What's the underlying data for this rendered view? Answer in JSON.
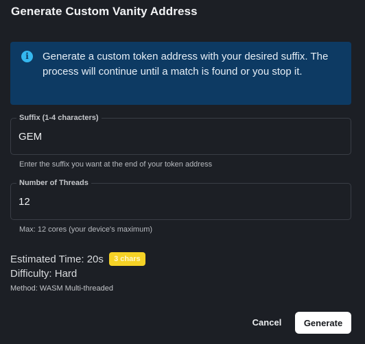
{
  "dialog": {
    "title": "Generate Custom Vanity Address"
  },
  "info": {
    "icon": "info-icon",
    "text": "Generate a custom token address with your desired suffix. The process will continue until a match is found or you stop it."
  },
  "suffix": {
    "label": "Suffix (1-4 characters)",
    "value": "GEM",
    "helper": "Enter the suffix you want at the end of your token address"
  },
  "threads": {
    "label": "Number of Threads",
    "value": "12",
    "helper": "Max: 12 cores (your device's maximum)"
  },
  "estimate": {
    "time_text": "Estimated Time: 20s",
    "chars_chip": "3 chars",
    "difficulty_text": "Difficulty: Hard",
    "method_text": "Method: WASM Multi-threaded"
  },
  "actions": {
    "cancel_label": "Cancel",
    "generate_label": "Generate"
  },
  "colors": {
    "background": "#1c1f25",
    "info_background": "#0d3a63",
    "info_icon": "#35b8f0",
    "chip_background": "#f5d226",
    "generate_button": "#ffffff"
  }
}
